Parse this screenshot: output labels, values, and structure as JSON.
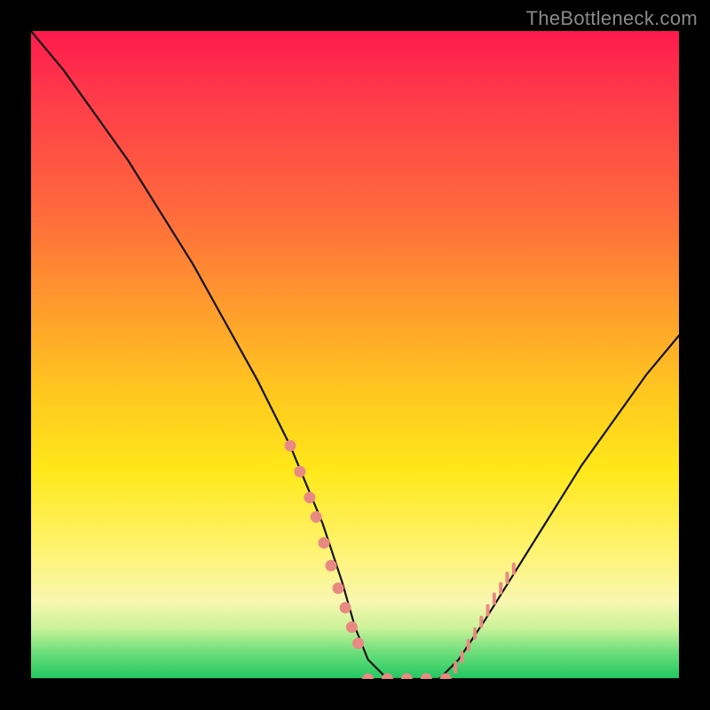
{
  "watermark": "TheBottleneck.com",
  "chart_data": {
    "type": "line",
    "title": "",
    "xlabel": "",
    "ylabel": "",
    "xlim": [
      0,
      100
    ],
    "ylim": [
      0,
      100
    ],
    "grid": false,
    "legend": false,
    "series": [
      {
        "name": "curve",
        "x": [
          0,
          5,
          10,
          15,
          20,
          25,
          30,
          35,
          40,
          45,
          48,
          50,
          52,
          55,
          58,
          60,
          63,
          66,
          70,
          75,
          80,
          85,
          90,
          95,
          100
        ],
        "y": [
          100,
          94,
          87,
          80,
          72,
          64,
          55,
          46,
          36,
          24,
          15,
          8,
          3,
          0,
          0,
          0,
          0,
          3,
          9,
          17,
          25,
          33,
          40,
          47,
          53
        ]
      }
    ],
    "baseline_y": 0,
    "annotations": {
      "left_dots": {
        "x": [
          40,
          41.5,
          43,
          44,
          45.2,
          46.3,
          47.4,
          48.5,
          49.5,
          50.5
        ],
        "y": [
          36,
          32,
          28,
          25,
          21,
          17.5,
          14,
          11,
          8,
          5.5
        ]
      },
      "floor_dots": {
        "x": [
          52,
          55,
          58,
          61,
          64
        ],
        "y": [
          0,
          0,
          0,
          0,
          0
        ]
      },
      "right_ticks": {
        "x": [
          65.5,
          66.5,
          67.5,
          68.5,
          69.5,
          70.5,
          71.5,
          72.5,
          73.5,
          74.5
        ],
        "y": [
          1.8,
          3.4,
          5.2,
          7.0,
          8.8,
          10.6,
          12.4,
          14.0,
          15.6,
          17.0
        ]
      }
    }
  }
}
